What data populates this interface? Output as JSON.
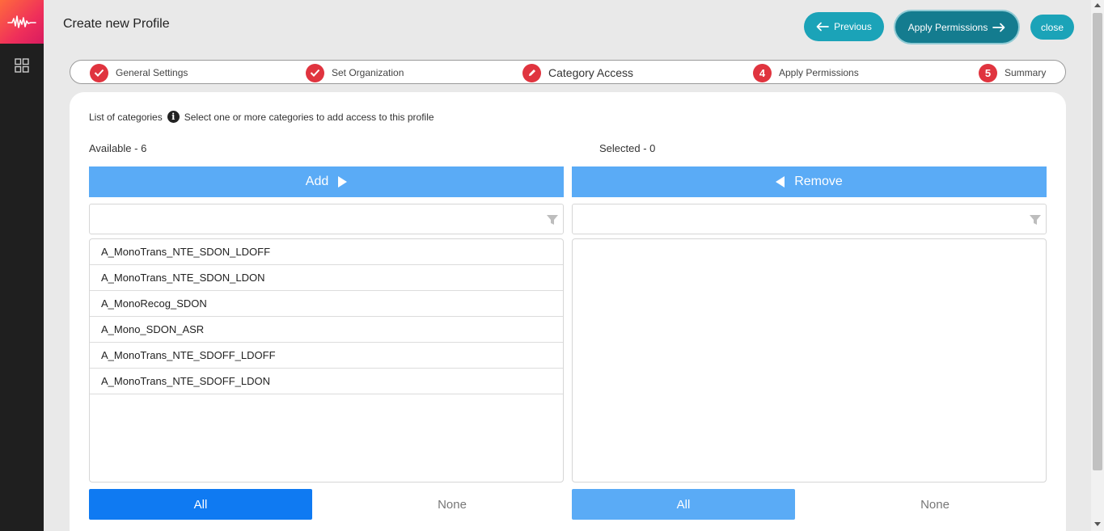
{
  "header": {
    "title": "Create new Profile",
    "previous_label": "Previous",
    "apply_label": "Apply Permissions",
    "close_label": "close"
  },
  "stepper": {
    "steps": [
      {
        "label": "General Settings",
        "state": "done"
      },
      {
        "label": "Set Organization",
        "state": "done"
      },
      {
        "label": "Category Access",
        "state": "active"
      },
      {
        "label": "Apply Permissions",
        "number": "4",
        "state": "pending"
      },
      {
        "label": "Summary",
        "number": "5",
        "state": "pending"
      }
    ]
  },
  "categories": {
    "heading": "List of categories",
    "hint": "Select one or more categories to add access to this profile",
    "available_label": "Available - 6",
    "selected_label": "Selected - 0",
    "add_label": "Add",
    "remove_label": "Remove",
    "available_filter_placeholder": "",
    "selected_filter_placeholder": "",
    "available_items": [
      "A_MonoTrans_NTE_SDON_LDOFF",
      "A_MonoTrans_NTE_SDON_LDON",
      "A_MonoRecog_SDON",
      "A_Mono_SDON_ASR",
      "A_MonoTrans_NTE_SDOFF_LDOFF",
      "A_MonoTrans_NTE_SDOFF_LDON"
    ],
    "selected_items": [],
    "available_all_label": "All",
    "available_none_label": "None",
    "selected_all_label": "All",
    "selected_none_label": "None"
  },
  "colors": {
    "brand_gradient_start": "#ff6a3d",
    "brand_gradient_end": "#d81b60",
    "teal_button": "#1ba3b8",
    "teal_button_dark": "#147c8f",
    "step_red": "#e0343f",
    "action_blue": "#5aabf6",
    "primary_blue": "#0f7af2"
  }
}
